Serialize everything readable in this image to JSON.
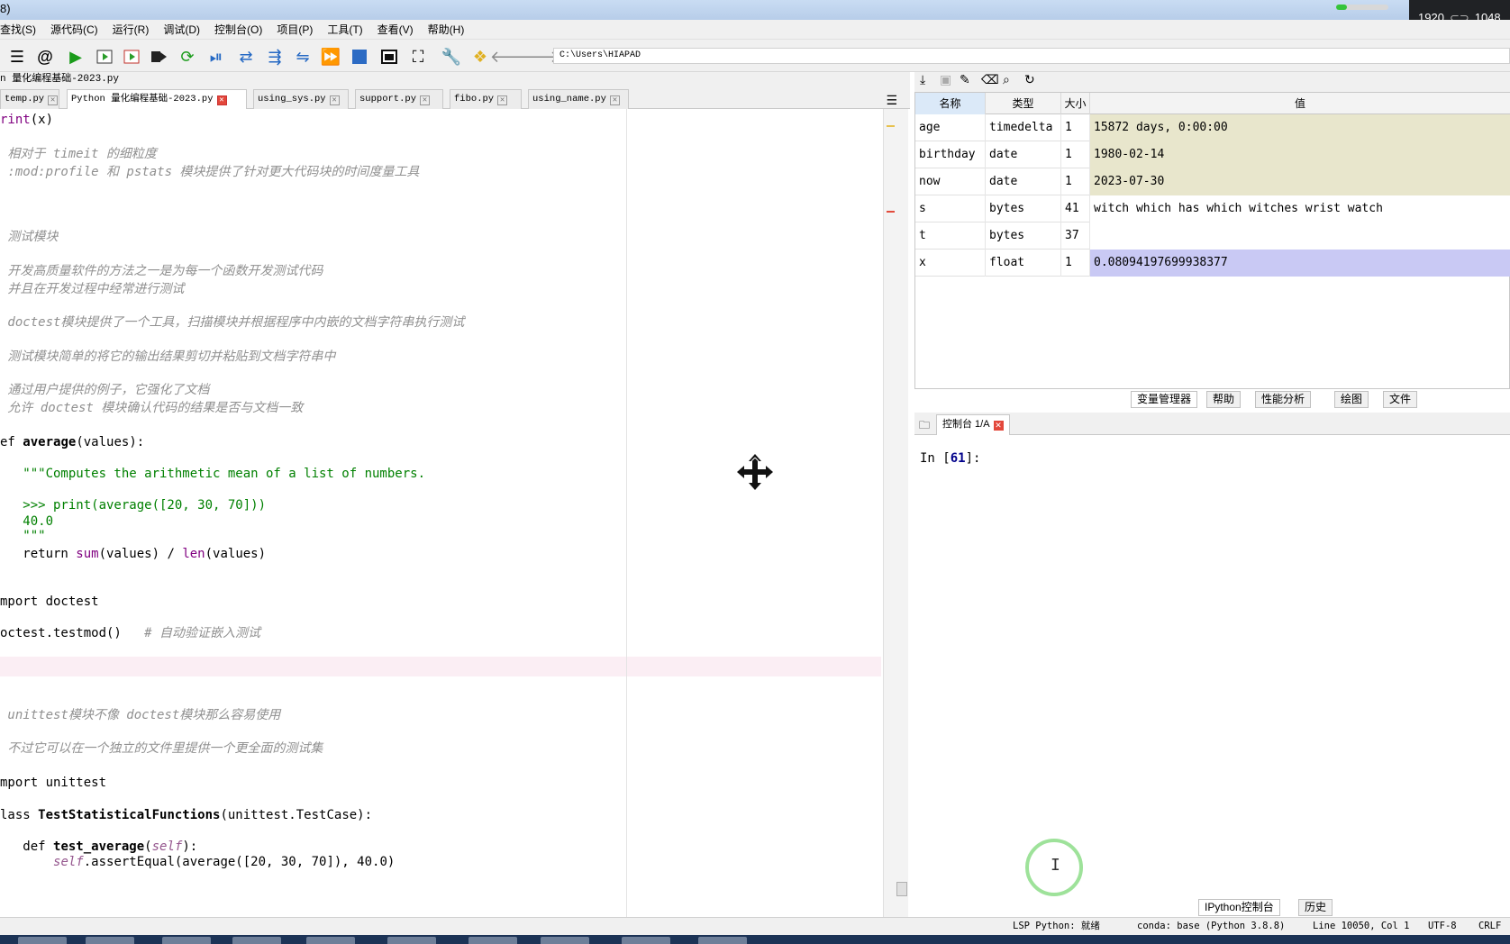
{
  "window": {
    "title_fragment": "8)",
    "resolution_overlay": {
      "width": "1920",
      "height": "1048"
    }
  },
  "menu": [
    "查找(S)",
    "源代码(C)",
    "运行(R)",
    "调试(D)",
    "控制台(O)",
    "项目(P)",
    "工具(T)",
    "查看(V)",
    "帮助(H)"
  ],
  "toolbar": {
    "icons": [
      "list-icon",
      "at-icon",
      "run-icon",
      "run-cell-icon",
      "run-cell-advance-icon",
      "run-selection-icon",
      "rerun-icon",
      "debug-icon",
      "step-icon",
      "step-into-icon",
      "step-return-icon",
      "continue-icon",
      "stop-icon",
      "maximize-pane-icon",
      "fullscreen-icon",
      "wrench-icon",
      "python-icon",
      "back-arrow-icon",
      "forward-arrow-icon"
    ],
    "path": "C:\\Users\\HIAPAD"
  },
  "editor": {
    "file_title": "n 量化编程基础-2023.py",
    "tabs": [
      {
        "label": "temp.py",
        "active": false
      },
      {
        "label": "Python 量化编程基础-2023.py",
        "active": true
      },
      {
        "label": "using_sys.py",
        "active": false
      },
      {
        "label": "support.py",
        "active": false
      },
      {
        "label": "fibo.py",
        "active": false
      },
      {
        "label": "using_name.py",
        "active": false
      }
    ],
    "lines": [
      {
        "parts": [
          [
            "bi",
            "rint"
          ],
          [
            "kw",
            "(x)"
          ]
        ]
      },
      {
        "parts": [
          [
            "cm",
            " 相对于 timeit 的细粒度"
          ]
        ]
      },
      {
        "parts": [
          [
            "cm",
            " :mod:profile 和 pstats 模块提供了针对更大代码块的时间度量工具"
          ]
        ]
      },
      {
        "parts": [
          [
            "cm",
            " 测试模块"
          ]
        ]
      },
      {
        "parts": [
          [
            "cm",
            " 开发高质量软件的方法之一是为每一个函数开发测试代码"
          ]
        ]
      },
      {
        "parts": [
          [
            "cm",
            " 并且在开发过程中经常进行测试"
          ]
        ]
      },
      {
        "parts": [
          [
            "cm",
            " doctest模块提供了一个工具，扫描模块并根据程序中内嵌的文档字符串执行测试"
          ]
        ]
      },
      {
        "parts": [
          [
            "cm",
            " 测试模块简单的将它的输出结果剪切并粘贴到文档字符串中"
          ]
        ]
      },
      {
        "parts": [
          [
            "cm",
            " 通过用户提供的例子，它强化了文档"
          ]
        ]
      },
      {
        "parts": [
          [
            "cm",
            " 允许 doctest 模块确认代码的结果是否与文档一致"
          ]
        ]
      },
      {
        "parts": [
          [
            "kw",
            "ef "
          ],
          [
            "kwb",
            "average"
          ],
          [
            "kw",
            "(values):"
          ]
        ]
      },
      {
        "parts": [
          [
            "st",
            "   \"\"\"Computes the arithmetic mean of a list of numbers."
          ]
        ]
      },
      {
        "parts": [
          [
            "st",
            "   >>> print(average([20, 30, 70]))"
          ]
        ]
      },
      {
        "parts": [
          [
            "st",
            "   40.0"
          ]
        ]
      },
      {
        "parts": [
          [
            "st",
            "   \"\"\""
          ]
        ]
      },
      {
        "parts": [
          [
            "kw",
            "   return "
          ],
          [
            "bi",
            "sum"
          ],
          [
            "kw",
            "(values) / "
          ],
          [
            "bi",
            "len"
          ],
          [
            "kw",
            "(values)"
          ]
        ]
      },
      {
        "parts": [
          [
            "kw",
            "mport doctest"
          ]
        ]
      },
      {
        "parts": [
          [
            "kw",
            "octest.testmod()   "
          ],
          [
            "cm",
            "# 自动验证嵌入测试"
          ]
        ]
      },
      {
        "parts": [
          [
            "cm",
            " unittest模块不像 doctest模块那么容易使用"
          ]
        ]
      },
      {
        "parts": [
          [
            "cm",
            " 不过它可以在一个独立的文件里提供一个更全面的测试集"
          ]
        ]
      },
      {
        "parts": [
          [
            "kw",
            "mport unittest"
          ]
        ]
      },
      {
        "parts": [
          [
            "kw",
            "lass "
          ],
          [
            "kwb",
            "TestStatisticalFunctions"
          ],
          [
            "kw",
            "(unittest.TestCase):"
          ]
        ]
      },
      {
        "parts": [
          [
            "kw",
            "   def "
          ],
          [
            "kwb",
            "test_average"
          ],
          [
            "kw",
            "("
          ],
          [
            "sf",
            "self"
          ],
          [
            "kw",
            "):"
          ]
        ]
      },
      {
        "parts": [
          [
            "kw",
            "       "
          ],
          [
            "sf",
            "self"
          ],
          [
            "kw",
            ".assertEqual(average([20, 30, 70]), 40.0)"
          ]
        ]
      }
    ]
  },
  "variable_explorer": {
    "headers": {
      "name": "名称",
      "type": "类型",
      "size": "大小",
      "value": "值"
    },
    "rows": [
      {
        "name": "age",
        "type": "timedelta",
        "size": "1",
        "value": "15872 days, 0:00:00",
        "color": "#e8e6cc"
      },
      {
        "name": "birthday",
        "type": "date",
        "size": "1",
        "value": "1980-02-14",
        "color": "#e8e6cc"
      },
      {
        "name": "now",
        "type": "date",
        "size": "1",
        "value": "2023-07-30",
        "color": "#e8e6cc"
      },
      {
        "name": "s",
        "type": "bytes",
        "size": "41",
        "value": "witch which has which witches wrist watch",
        "color": "#ffffff"
      },
      {
        "name": "t",
        "type": "bytes",
        "size": "37",
        "value": "",
        "color": "#ffffff"
      },
      {
        "name": "x",
        "type": "float",
        "size": "1",
        "value": "0.08094197699938377",
        "color": "#c9c9f4"
      }
    ],
    "pane_tabs": [
      "变量管理器",
      "帮助",
      "性能分析",
      "绘图",
      "文件"
    ]
  },
  "console": {
    "tab_label": "控制台 1/A",
    "prompt_prefix": "In [",
    "prompt_number": "61",
    "prompt_suffix": "]:",
    "bottom_tabs": [
      "IPython控制台",
      "历史"
    ]
  },
  "statusbar": {
    "lsp": "LSP Python: 就绪",
    "conda": "conda: base (Python 3.8.8)",
    "position": "Line 10050, Col 1",
    "encoding": "UTF-8",
    "eol": "CRLF"
  }
}
